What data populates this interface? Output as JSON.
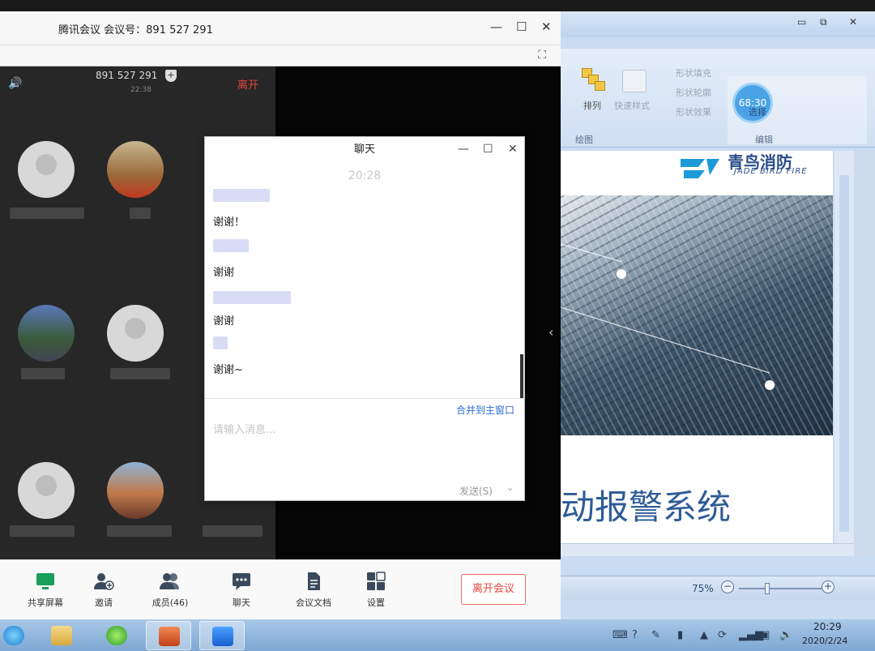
{
  "meeting": {
    "window_title": "腾讯会议 会议号：891 527 291",
    "meeting_id": "891 527 291",
    "duration": "22:38",
    "leave_label": "离开",
    "toolbar": [
      {
        "label": "共享屏幕",
        "icon": "screen-share-icon"
      },
      {
        "label": "邀请",
        "icon": "invite-user-icon"
      },
      {
        "label": "成员(46)",
        "icon": "members-icon"
      },
      {
        "label": "聊天",
        "icon": "chat-icon"
      },
      {
        "label": "会议文档",
        "icon": "document-icon"
      },
      {
        "label": "设置",
        "icon": "settings-grid-icon"
      }
    ],
    "end_meeting_label": "离开会议"
  },
  "chat": {
    "title": "聊天",
    "timestamp": "20:28",
    "messages": [
      {
        "text": "谢谢！"
      },
      {
        "text": "谢谢"
      },
      {
        "text": "谢谢"
      },
      {
        "text": "谢谢~"
      }
    ],
    "merge_label": "合并到主窗口",
    "input_placeholder": "请输入消息...",
    "send_label": "发送(S)"
  },
  "doc": {
    "ribbon": {
      "arrange": "排列",
      "quick_styles": "快速样式",
      "shape_fill": "形状填充",
      "shape_outline": "形状轮廓",
      "shape_effects": "形状效果",
      "select": "选择",
      "group_draw": "绘图",
      "group_edit": "编辑"
    },
    "timer": "68:30",
    "slide": {
      "logo_text": "青鸟消防",
      "logo_sub": "JADE BIRD FIRE",
      "heading": "动报警系统"
    },
    "zoom": "75%"
  },
  "taskbar": {
    "time": "20:29",
    "date": "2020/2/24"
  }
}
